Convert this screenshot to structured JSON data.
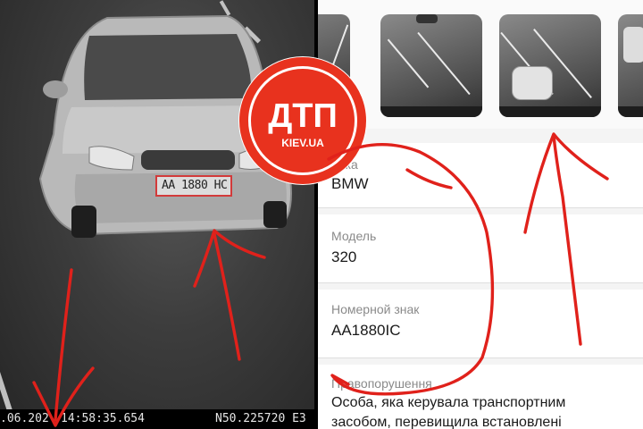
{
  "camera": {
    "plate_text": "AA 1880 HC",
    "timestamp_date": ".06.202",
    "timestamp_time": "14:58:35.654",
    "coordinates": "N50.225720 E3"
  },
  "logo": {
    "title": "ДТП",
    "site": "KIEV.UA",
    "color": "#e8321e"
  },
  "vehicle_info": {
    "fields": [
      {
        "label": "арка",
        "value": "BMW"
      },
      {
        "label": "Модель",
        "value": "320"
      },
      {
        "label": "Номерной знак",
        "value": "AA1880IC"
      },
      {
        "label": "Правопорушення",
        "value_lines": [
          "Особа, яка керувала транспортним",
          "засобом, перевищила встановлені"
        ]
      }
    ]
  },
  "annotation_color": "#e0211b"
}
